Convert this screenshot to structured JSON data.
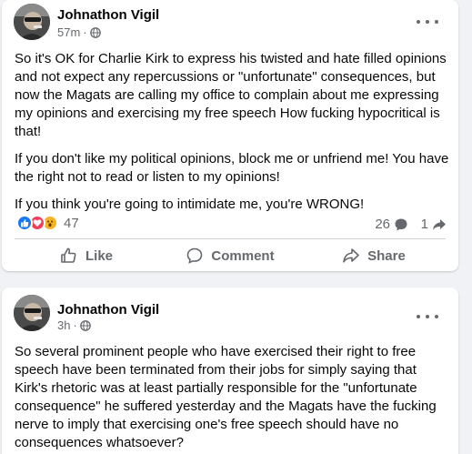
{
  "posts": [
    {
      "author": "Johnathon Vigil",
      "time": "57m",
      "privacy_icon": "globe-icon",
      "paragraphs": [
        "So it's OK for Charlie Kirk to express his twisted and hate filled opinions and not expect any repercussions or \"unfortunate\" consequences, but now the Magats are calling my office to complain about me expressing my opinions and exercising my free speech How fucking hypocritical is that!",
        "If you don't like my political opinions, block me or unfriend me! You have the right not to read or listen to my opinions!",
        "If you think you're going to intimidate me, you're WRONG!"
      ],
      "reaction_icons": [
        "like-icon",
        "love-icon",
        "wow-icon"
      ],
      "reaction_count": "47",
      "comment_count": "26",
      "share_count": "1",
      "actions": {
        "like": "Like",
        "comment": "Comment",
        "share": "Share"
      }
    },
    {
      "author": "Johnathon Vigil",
      "time": "3h",
      "privacy_icon": "globe-icon",
      "paragraphs": [
        "So several prominent people who have exercised their right to free speech have been terminated from their jobs for simply saying that Kirk's rhetoric was at least partially responsible for the \"unfortunate consequence\" he suffered yesterday and the Magats have the fucking nerve to imply that exercising one's free speech should have no consequences whatsoever?"
      ]
    }
  ],
  "colors": {
    "background": "#f0f2f5",
    "card": "#ffffff",
    "secondary_text": "#65686c",
    "like_blue": "#1877f2",
    "love_red": "#f33e58",
    "wow_yellow": "#f7b125"
  }
}
